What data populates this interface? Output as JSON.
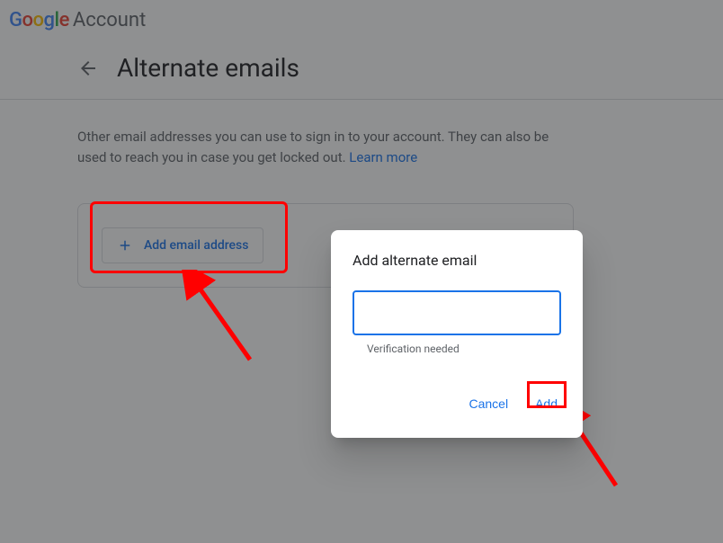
{
  "header": {
    "brand": "Google",
    "product": "Account"
  },
  "page": {
    "title": "Alternate emails",
    "description_part1": "Other email addresses you can use to sign in to your account. They can also be used to reach you in case you get locked out. ",
    "learn_more": "Learn more"
  },
  "card": {
    "add_button_label": "Add email address"
  },
  "dialog": {
    "title": "Add alternate email",
    "input_value": "",
    "helper_text": "Verification needed",
    "cancel_label": "Cancel",
    "add_label": "Add"
  },
  "annotations": {
    "highlight_color": "#ff0000"
  }
}
